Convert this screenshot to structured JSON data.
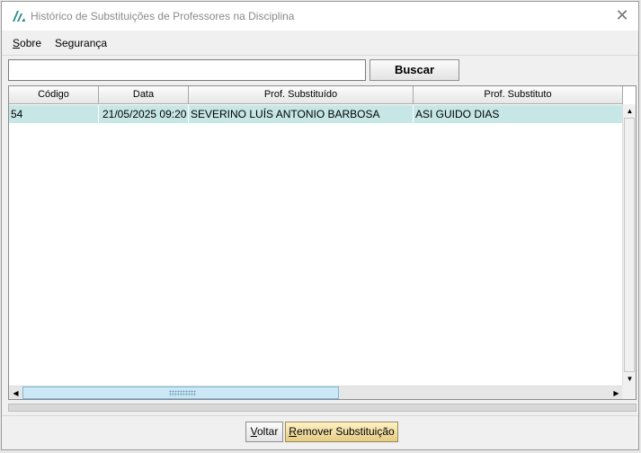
{
  "window": {
    "title": "Histórico de Substituições de Professores na Disciplina",
    "close_glyph": "✕",
    "logo_icon": "app-logo-icon"
  },
  "menu": {
    "items": [
      {
        "label": "Sobre",
        "mnemonic": "S",
        "rest": "obre"
      },
      {
        "label": "Segurança"
      }
    ]
  },
  "search": {
    "value": "",
    "placeholder": "",
    "button_label": "Buscar"
  },
  "table": {
    "columns": [
      "Código",
      "Data",
      "Prof. Substituído",
      "Prof. Substituto"
    ],
    "rows": [
      [
        "54",
        "21/05/2025 09:20",
        "SEVERINO LUÍS ANTONIO BARBOSA",
        "ASI GUIDO DIAS"
      ]
    ],
    "selected_row_color": "#c7e6e6"
  },
  "scroll": {
    "up_arrow": "▲",
    "down_arrow": "▼",
    "left_arrow": "◀",
    "right_arrow": "▶"
  },
  "footer": {
    "back_label": "Voltar",
    "back_mnemonic": "V",
    "back_rest": "oltar",
    "remove_label": "Remover Substituição",
    "remove_mnemonic": "R",
    "remove_rest": "emover Substituição"
  }
}
